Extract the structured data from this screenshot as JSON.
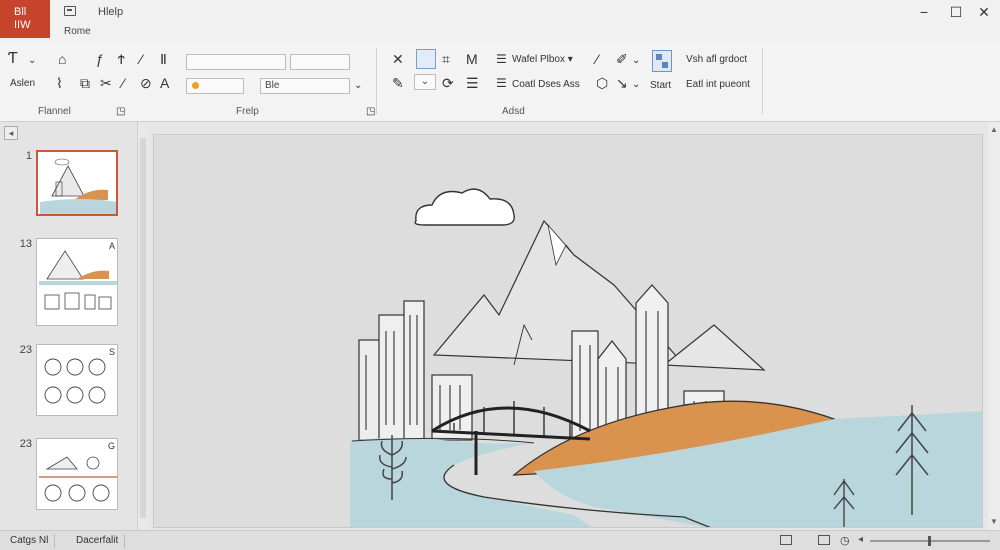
{
  "app": {
    "badge_line1": "Bll",
    "badge_line2": "IIW"
  },
  "menu": {
    "help": "Hlelp",
    "home": "Rome"
  },
  "window_controls": {
    "minimize": "−",
    "maximize": "☐",
    "close": "✕"
  },
  "ribbon": {
    "left_button_label": "Aslen",
    "font_box": "",
    "style_box": "Ble",
    "panel_text_1": "Wafel Plbox ▾",
    "panel_text_2": "Coatl Dses Ass",
    "start_label": "Start",
    "right_line_1": "Vsh afl grdoct",
    "right_line_2": "Eatl int pueont",
    "group_labels": [
      "Flannel",
      "Frelp",
      "Adsd"
    ]
  },
  "thumbnails": [
    {
      "number": "1",
      "badge": ""
    },
    {
      "number": "13",
      "badge": "A"
    },
    {
      "number": "23",
      "badge": "S"
    },
    {
      "number": "23",
      "badge": "G"
    }
  ],
  "status": {
    "left": "Catgs Nl",
    "view": "Dacerfalit"
  },
  "colors": {
    "accent_red": "#c7432b",
    "hill_orange": "#d9934f",
    "water_blue": "#b9d6dc",
    "selection_border": "#c8583c"
  }
}
